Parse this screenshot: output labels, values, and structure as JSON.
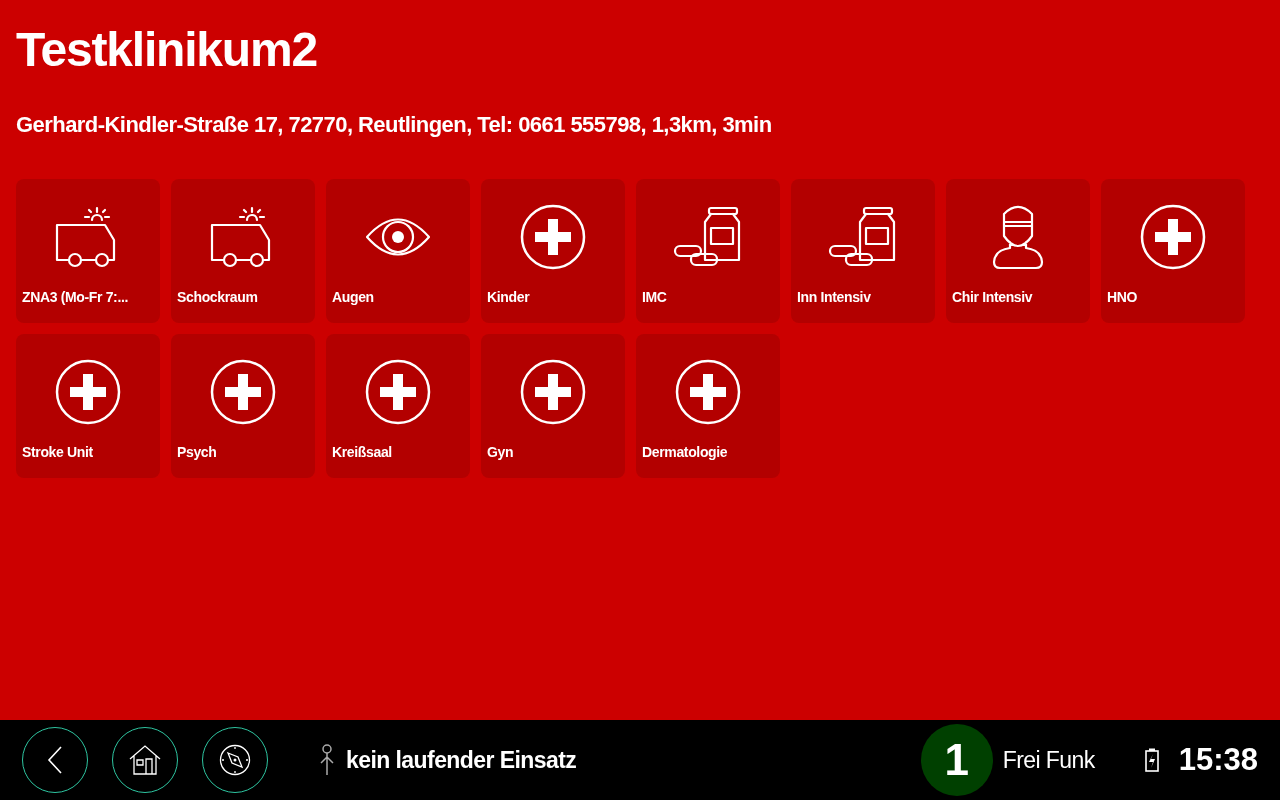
{
  "hospital": {
    "name": "Testklinikum2",
    "details": "Gerhard-Kindler-Straße 17, 72770, Reutlingen, Tel: 0661 555798, 1,3km, 3min"
  },
  "departments": [
    {
      "label": "ZNA3 (Mo-Fr 7:...",
      "kind": "ambulance"
    },
    {
      "label": "Schockraum",
      "kind": "ambulance"
    },
    {
      "label": "Augen",
      "kind": "eye"
    },
    {
      "label": "Kinder",
      "kind": "cross"
    },
    {
      "label": "IMC",
      "kind": "medication"
    },
    {
      "label": "Inn Intensiv",
      "kind": "medication"
    },
    {
      "label": "Chir Intensiv",
      "kind": "surgeon"
    },
    {
      "label": "HNO",
      "kind": "cross"
    },
    {
      "label": "Stroke Unit",
      "kind": "cross"
    },
    {
      "label": "Psych",
      "kind": "cross"
    },
    {
      "label": "Kreißsaal",
      "kind": "cross"
    },
    {
      "label": "Gyn",
      "kind": "cross"
    },
    {
      "label": "Dermatologie",
      "kind": "cross"
    }
  ],
  "bottom_bar": {
    "mission_status": "kein laufender Einsatz",
    "radio_status": "1",
    "radio_label": "Frei Funk",
    "time": "15:38"
  }
}
